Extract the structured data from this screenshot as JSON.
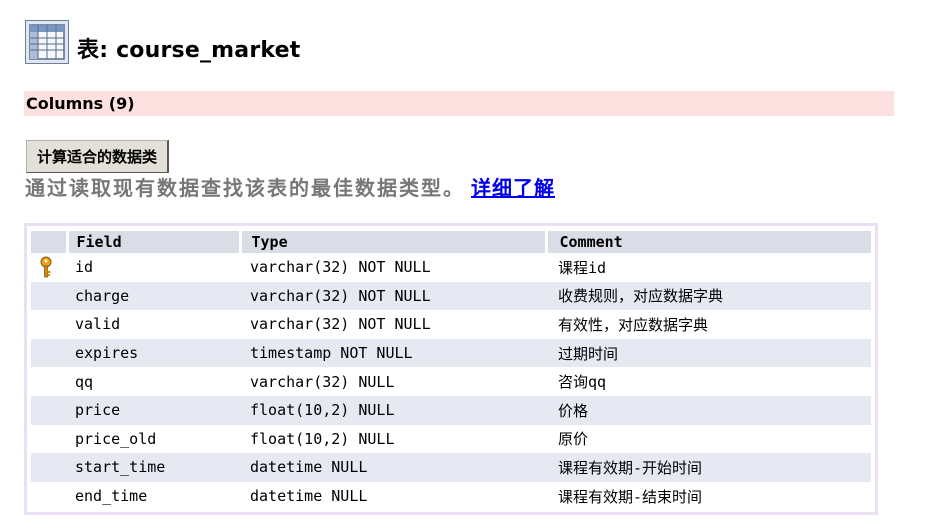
{
  "header": {
    "title_prefix": "表:",
    "table_name": "course_market"
  },
  "columns_bar": {
    "label": "Columns (9)"
  },
  "calc_button": {
    "label": "计算适合的数据类"
  },
  "description": {
    "text": "通过读取现有数据查找该表的最佳数据类型。",
    "link": "详细了解"
  },
  "table": {
    "headers": {
      "field": "Field",
      "type": "Type",
      "comment": "Comment"
    },
    "rows": [
      {
        "key": true,
        "field": "id",
        "type": "varchar(32) NOT NULL",
        "comment": "课程id"
      },
      {
        "key": false,
        "field": "charge",
        "type": "varchar(32) NOT NULL",
        "comment": "收费规则，对应数据字典"
      },
      {
        "key": false,
        "field": "valid",
        "type": "varchar(32) NOT NULL",
        "comment": "有效性，对应数据字典"
      },
      {
        "key": false,
        "field": "expires",
        "type": "timestamp NOT NULL",
        "comment": "过期时间"
      },
      {
        "key": false,
        "field": "qq",
        "type": "varchar(32) NULL",
        "comment": "咨询qq"
      },
      {
        "key": false,
        "field": "price",
        "type": "float(10,2) NULL",
        "comment": "价格"
      },
      {
        "key": false,
        "field": "price_old",
        "type": "float(10,2) NULL",
        "comment": "原价"
      },
      {
        "key": false,
        "field": "start_time",
        "type": "datetime NULL",
        "comment": "课程有效期-开始时间"
      },
      {
        "key": false,
        "field": "end_time",
        "type": "datetime NULL",
        "comment": "课程有效期-结束时间"
      }
    ]
  },
  "icons": {
    "table": "table-grid-icon",
    "primary_key": "key-icon"
  },
  "colors": {
    "columns_bar_bg": "#fde1e1",
    "header_row_bg": "#dbdde6",
    "alt_row_bg": "#e6e8f2",
    "link": "#0000ee",
    "key_icon": "#e8a21a"
  }
}
